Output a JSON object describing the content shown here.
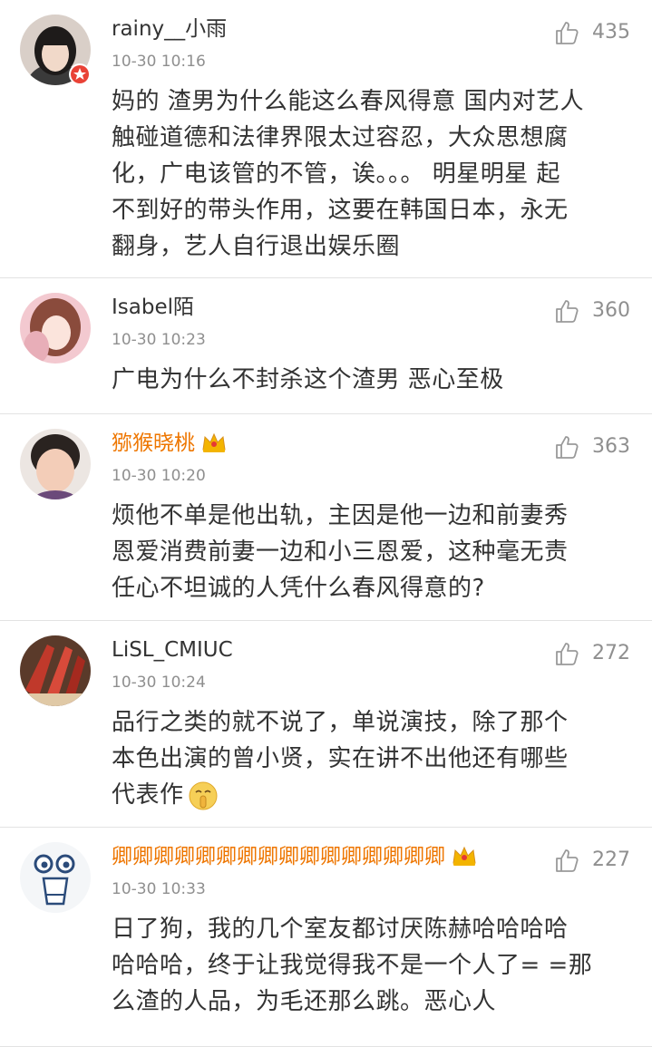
{
  "comments": [
    {
      "username": "rainy__小雨",
      "time": "10-30 10:16",
      "likes": "435",
      "text_lines": [
        "妈的 渣男为什么能这么春风得意 国内对艺人",
        "触碰道德和法律界限太过容忍，大众思想腐",
        "化，广电该管的不管，诶。。。 明星明星 起",
        "不到好的带头作用，这要在韩国日本，永无",
        "翻身，艺人自行退出娱乐圈"
      ]
    },
    {
      "username": "Isabel陌",
      "time": "10-30 10:23",
      "likes": "360",
      "text_lines": [
        "广电为什么不封杀这个渣男 恶心至极"
      ]
    },
    {
      "username": "猕猴晓桃",
      "time": "10-30 10:20",
      "likes": "363",
      "text_lines": [
        "烦他不单是他出轨，主因是他一边和前妻秀",
        "恩爱消费前妻一边和小三恩爱，这种毫无责",
        "任心不坦诚的人凭什么春风得意的?"
      ]
    },
    {
      "username": "LiSL_CMIUC",
      "time": "10-30 10:24",
      "likes": "272",
      "text_lines": [
        "品行之类的就不说了，单说演技，除了那个",
        "本色出演的曾小贤，实在讲不出他还有哪些",
        "代表作"
      ]
    },
    {
      "username": "卿卿卿卿卿卿卿卿卿卿卿卿卿卿卿卿",
      "time": "10-30 10:33",
      "likes": "227",
      "text_lines": [
        "日了狗，我的几个室友都讨厌陈赫哈哈哈哈",
        "哈哈哈，终于让我觉得我不是一个人了= =那",
        "么渣的人品，为毛还那么跳。恶心人"
      ]
    }
  ],
  "icons": {
    "like": "thumbs-up-icon",
    "verified": "verified-badge-icon",
    "member": "crown-icon",
    "emoji": "shush-emoji-icon"
  },
  "colors": {
    "vip_name": "#ee7600",
    "verified_badge": "#e94236",
    "meta_gray": "#8f8f8f"
  }
}
